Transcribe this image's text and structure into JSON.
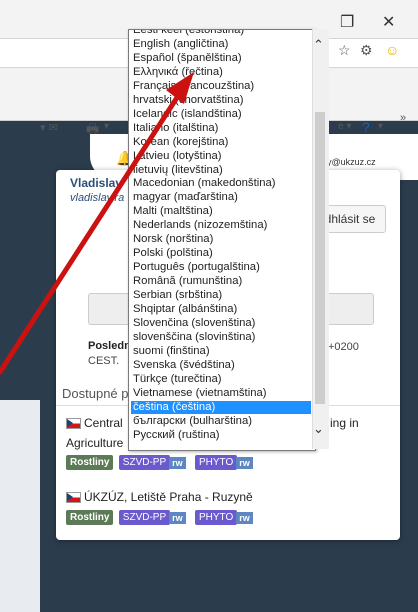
{
  "window": {
    "restore_label": "❐",
    "close_label": "✕"
  },
  "account": {
    "name": "Vladislav",
    "sub": "vladislav.ra",
    "email": "sky@ukzuz.cz",
    "logout_label": "dhlásit se",
    "last_label": "Posledn",
    "tz_prefix": "CEST.",
    "tz_suffix": "+0200"
  },
  "available_heading": "Dostupné p",
  "orgs": [
    {
      "name_start": "Central",
      "name_end": "ing in",
      "line2": "Agriculture"
    },
    {
      "name": "ÚKZÚZ, Letiště Praha - Ruzyně"
    }
  ],
  "badges": {
    "rostliny": "Rostliny",
    "szvd": "SZVD-PP",
    "rw": "rw",
    "phyto": "PHYTO"
  },
  "languages": [
    "Eesti keel (estonština)",
    "English (angličtina)",
    "Español (španělština)",
    "Ελληνικά (řečtina)",
    "Français (francouzština)",
    "hrvatski (chorvatština)",
    "Icelandic (islandština)",
    "Italiano (italština)",
    "Korean (korejština)",
    "Latvieu (lotyština)",
    "lietuvių (litevština)",
    "Macedonian (makedonština)",
    "magyar (maďarština)",
    "Malti (maltština)",
    "Nederlands (nizozemština)",
    "Norsk (norština)",
    "Polski (polština)",
    "Português (portugalština)",
    "Română (rumunština)",
    "Serbian (srbština)",
    "Shqiptar (albánština)",
    "Slovenčina (slovenština)",
    "slovenščina (slovinština)",
    "suomi (finština)",
    "Svenska (švédština)",
    "Türkçe (turečtina)",
    "Vietnamese (vietnamština)",
    "čeština (čeština)",
    "български (bulharština)",
    "Русский (ruština)"
  ],
  "selected_language_index": 27,
  "colors": {
    "selected": "#1e90ff",
    "arrow": "#cc1111",
    "page_bg": "#2b3d4d"
  }
}
